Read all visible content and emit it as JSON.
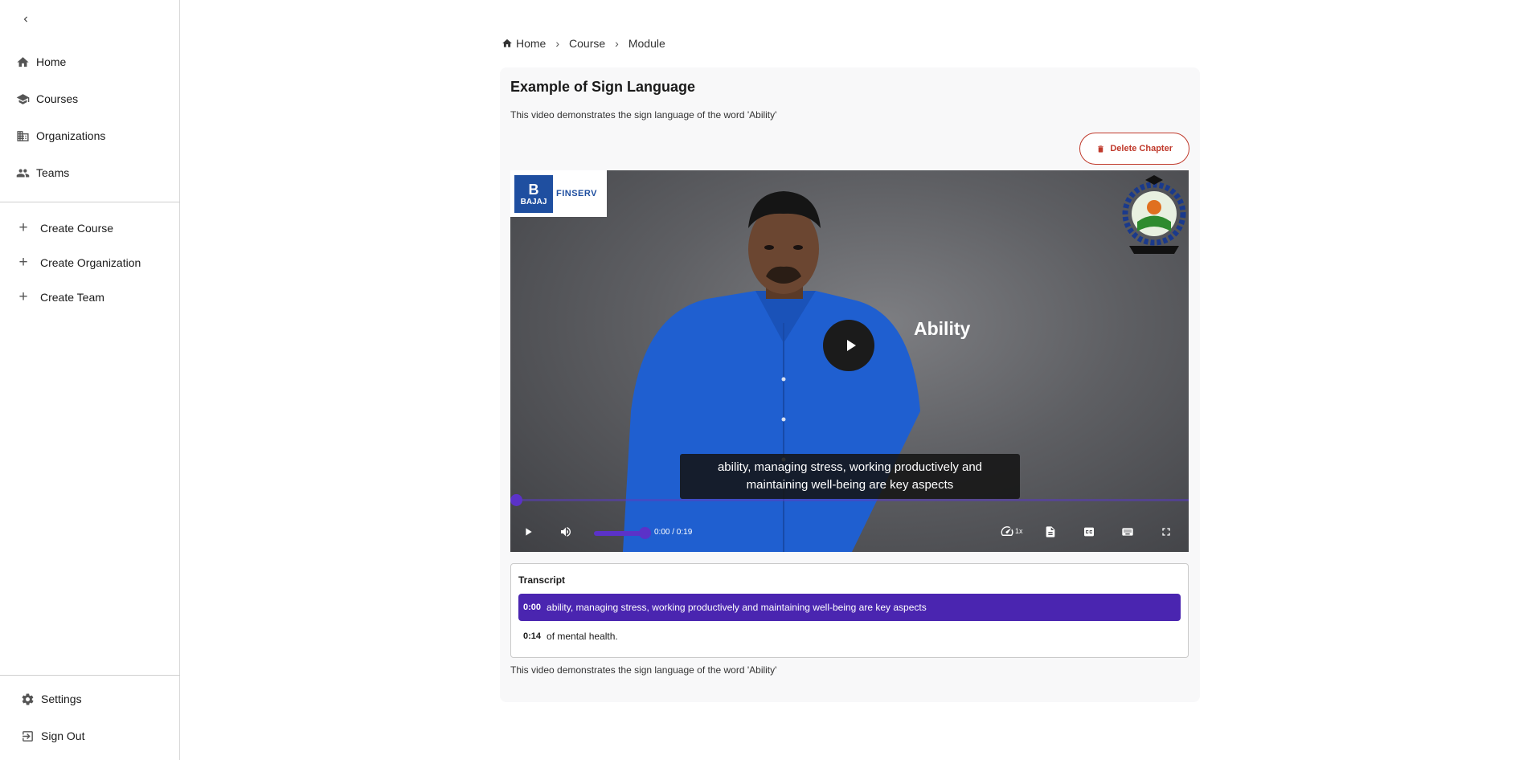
{
  "sidebar": {
    "nav": [
      {
        "label": "Home",
        "icon": "home-icon"
      },
      {
        "label": "Courses",
        "icon": "school-icon"
      },
      {
        "label": "Organizations",
        "icon": "building-icon"
      },
      {
        "label": "Teams",
        "icon": "people-icon"
      }
    ],
    "create": [
      {
        "label": "Create Course"
      },
      {
        "label": "Create Organization"
      },
      {
        "label": "Create Team"
      }
    ],
    "bottom": [
      {
        "label": "Settings",
        "icon": "gear-icon"
      },
      {
        "label": "Sign Out",
        "icon": "sign-out-icon"
      }
    ]
  },
  "breadcrumb": [
    "Home",
    "Course",
    "Module"
  ],
  "chapter": {
    "title": "Example of Sign Language",
    "description": "This video demonstrates the sign language of the word 'Ability'",
    "delete_label": "Delete Chapter",
    "footer": "This video demonstrates the sign language of the word 'Ability'"
  },
  "video": {
    "logo_text_b": "BAJAJ",
    "logo_text_finserv": "FINSERV",
    "word": "Ability",
    "subtitle": "ability, managing stress, working productively and maintaining well-being are key aspects",
    "time": "0:00 / 0:19",
    "speed": "1x",
    "progress": 0,
    "volume": 1.0
  },
  "transcript": {
    "title": "Transcript",
    "rows": [
      {
        "time": "0:00",
        "text": "ability, managing stress, working productively and maintaining well-being are key aspects",
        "active": true
      },
      {
        "time": "0:14",
        "text": "of mental health.",
        "active": false
      }
    ]
  },
  "colors": {
    "accent": "#4a25b0",
    "danger": "#c0392b",
    "shirt": "#1f5fd0"
  }
}
